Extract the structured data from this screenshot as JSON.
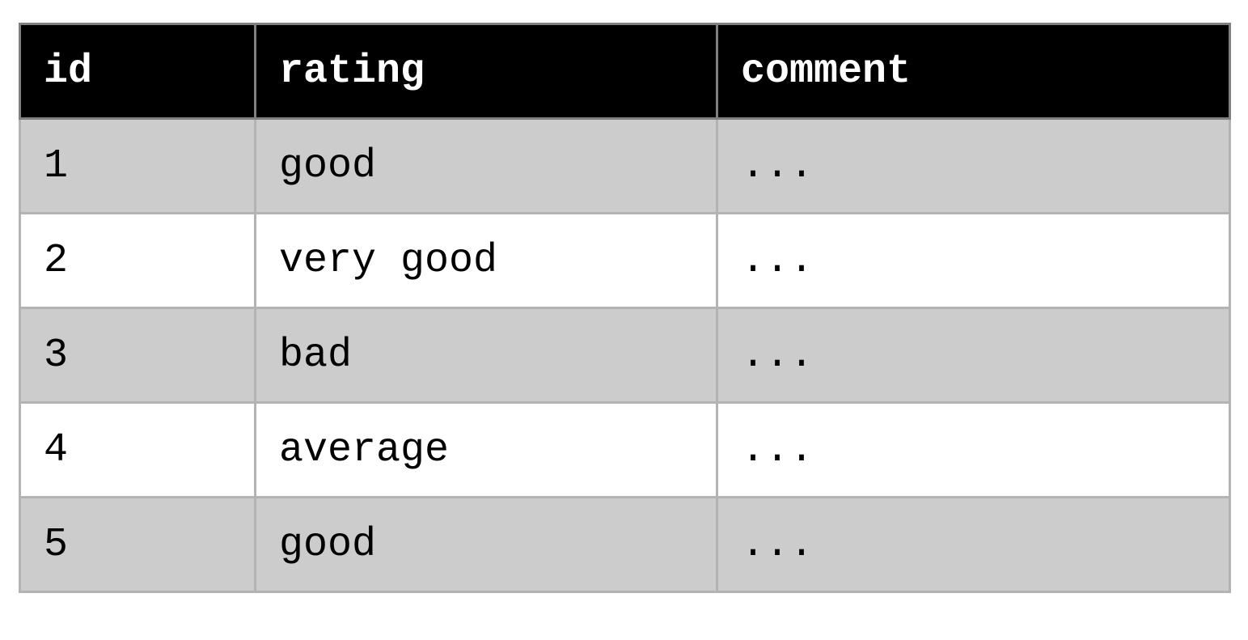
{
  "table": {
    "headers": [
      "id",
      "rating",
      "comment"
    ],
    "rows": [
      [
        "1",
        "good",
        "..."
      ],
      [
        "2",
        "very good",
        "..."
      ],
      [
        "3",
        "bad",
        "..."
      ],
      [
        "4",
        "average",
        "..."
      ],
      [
        "5",
        "good",
        "..."
      ]
    ]
  },
  "colors": {
    "header_background": "#000000",
    "header_text": "#ffffff",
    "odd_row_background": "#cccccc",
    "even_row_background": "#ffffff",
    "grid_line": "#b3b3b3"
  }
}
